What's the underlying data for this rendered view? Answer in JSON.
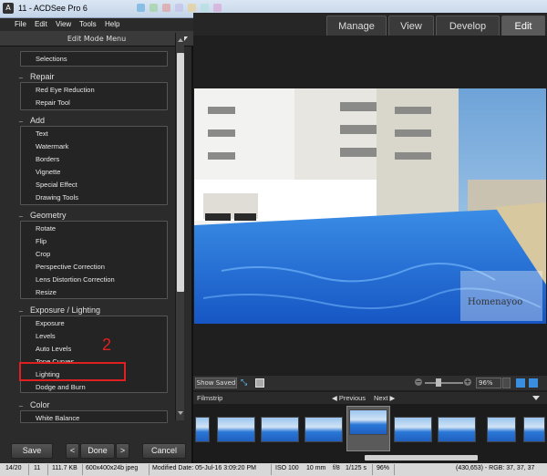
{
  "titlebar": {
    "title": "11 - ACDSee Pro 6",
    "icon": "acdsee-app-icon"
  },
  "menubar": {
    "file": "File",
    "edit": "Edit",
    "view": "View",
    "tools": "Tools",
    "help": "Help"
  },
  "modetabs": {
    "manage": "Manage",
    "view": "View",
    "develop": "Develop",
    "edit": "Edit"
  },
  "panel": {
    "header": "Edit Mode Menu",
    "groups": {
      "repair": "Repair",
      "add": "Add",
      "geometry": "Geometry",
      "exposure": "Exposure / Lighting",
      "color": "Color"
    },
    "items": {
      "selections": "Selections",
      "red_eye": "Red Eye Reduction",
      "repair_tool": "Repair Tool",
      "text": "Text",
      "watermark": "Watermark",
      "borders": "Borders",
      "vignette": "Vignette",
      "special_effect": "Special Effect",
      "drawing_tools": "Drawing Tools",
      "rotate": "Rotate",
      "flip": "Flip",
      "crop": "Crop",
      "perspective": "Perspective Correction",
      "lens": "Lens Distortion Correction",
      "resize": "Resize",
      "exposure": "Exposure",
      "levels": "Levels",
      "auto_levels": "Auto Levels",
      "tone_curves": "Tone Curves",
      "lighting": "Lighting",
      "dodge_burn": "Dodge and Burn",
      "white_balance": "White Balance"
    },
    "annotation_number": "2",
    "buttons": {
      "save": "Save",
      "prev": "<",
      "done": "Done",
      "next": ">",
      "cancel": "Cancel"
    }
  },
  "viewer": {
    "show_saved": "Show Saved",
    "zoom": "96%",
    "watermark_text": "Homenayoo"
  },
  "filmstrip": {
    "label": "Filmstrip",
    "previous": "◀ Previous",
    "next": "Next ▶"
  },
  "statusbar": {
    "position": "14/20",
    "name": "11",
    "filesize": "111.7 KB",
    "dims": "600x400x24b jpeg",
    "modified": "Modified Date: 05-Jul-16 3:09:20 PM",
    "iso": "ISO 100",
    "focal": "10 mm",
    "fstop": "f/8",
    "shutter": "1/125 s",
    "zoom": "96%",
    "pixel": "(430,653) - RGB: 37, 37, 37"
  },
  "colors": {
    "accent_red": "#e02020",
    "panel_bg": "#2b2b2b"
  }
}
